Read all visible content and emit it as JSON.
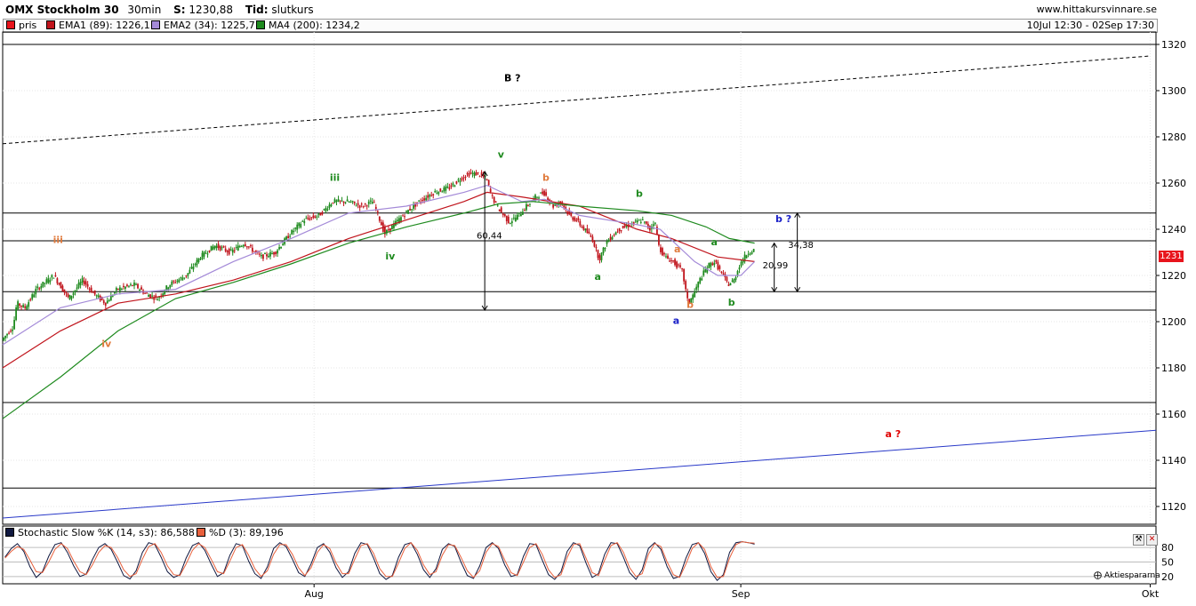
{
  "header": {
    "instrument": "OMX Stockholm 30",
    "interval": "30min",
    "s_label": "S:",
    "s_value": "1230,88",
    "tid_label": "Tid:",
    "tid_value": "slutkurs",
    "site": "www.hittakursvinnare.se"
  },
  "legend": {
    "items": [
      {
        "label": "pris",
        "color": "#e8141c"
      },
      {
        "label": "EMA1 (89): 1226,1",
        "color": "#c0141c"
      },
      {
        "label": "EMA2 (34): 1225,7",
        "color": "#a48ad8"
      },
      {
        "label": "MA4 (200): 1234,2",
        "color": "#1e8a1e"
      }
    ],
    "range": "10Jul 12:30 - 02Sep 17:30"
  },
  "last_price_badge": "1231",
  "stoch_legend": {
    "items": [
      {
        "label": "Stochastic Slow %K (14, s3): 86,588",
        "color": "#101840"
      },
      {
        "label": "%D (3): 89,196",
        "color": "#e8603c"
      }
    ]
  },
  "brand": "Aktiespararna",
  "icons": [
    "wrench-icon",
    "close-icon",
    "aktiespararna-logo-icon"
  ],
  "colors": {
    "up_candle": "#1e8a1e",
    "down_candle": "#c0141c",
    "trend_blue": "#2838c8",
    "label_green": "#1e8a1e",
    "label_orange": "#e07a3c",
    "label_blue": "#1a20c8",
    "label_red": "#e00000"
  },
  "chart_data": [
    {
      "type": "candlestick",
      "ylim": [
        1112,
        1324
      ],
      "y_ticks": [
        1120,
        1140,
        1160,
        1180,
        1200,
        1220,
        1240,
        1260,
        1280,
        1300,
        1320
      ],
      "x_ticks": [
        {
          "label": "Aug",
          "t": 0.27
        },
        {
          "label": "Sep",
          "t": 0.64
        },
        {
          "label": "Okt",
          "t": 0.995
        }
      ],
      "grid": true,
      "price_path": [
        [
          0,
          1192
        ],
        [
          0.01,
          1198
        ],
        [
          0.013,
          1208
        ],
        [
          0.02,
          1206
        ],
        [
          0.03,
          1214
        ],
        [
          0.045,
          1220
        ],
        [
          0.058,
          1210
        ],
        [
          0.07,
          1218
        ],
        [
          0.08,
          1212
        ],
        [
          0.09,
          1208
        ],
        [
          0.1,
          1214
        ],
        [
          0.115,
          1216
        ],
        [
          0.125,
          1212
        ],
        [
          0.135,
          1210
        ],
        [
          0.145,
          1216
        ],
        [
          0.16,
          1220
        ],
        [
          0.172,
          1228
        ],
        [
          0.185,
          1233
        ],
        [
          0.198,
          1230
        ],
        [
          0.21,
          1234
        ],
        [
          0.225,
          1228
        ],
        [
          0.237,
          1230
        ],
        [
          0.25,
          1238
        ],
        [
          0.262,
          1244
        ],
        [
          0.275,
          1246
        ],
        [
          0.287,
          1252
        ],
        [
          0.3,
          1252
        ],
        [
          0.312,
          1250
        ],
        [
          0.322,
          1252
        ],
        [
          0.332,
          1238
        ],
        [
          0.342,
          1243
        ],
        [
          0.352,
          1248
        ],
        [
          0.362,
          1252
        ],
        [
          0.375,
          1256
        ],
        [
          0.388,
          1258
        ],
        [
          0.398,
          1262
        ],
        [
          0.405,
          1264
        ],
        [
          0.413,
          1264
        ],
        [
          0.42,
          1262
        ],
        [
          0.425,
          1254
        ],
        [
          0.432,
          1248
        ],
        [
          0.44,
          1243
        ],
        [
          0.448,
          1246
        ],
        [
          0.455,
          1250
        ],
        [
          0.463,
          1254
        ],
        [
          0.47,
          1256
        ],
        [
          0.478,
          1250
        ],
        [
          0.485,
          1252
        ],
        [
          0.492,
          1246
        ],
        [
          0.498,
          1244
        ],
        [
          0.505,
          1240
        ],
        [
          0.512,
          1236
        ],
        [
          0.518,
          1227
        ],
        [
          0.525,
          1235
        ],
        [
          0.535,
          1240
        ],
        [
          0.545,
          1242
        ],
        [
          0.555,
          1244
        ],
        [
          0.562,
          1240
        ],
        [
          0.566,
          1244
        ],
        [
          0.57,
          1232
        ],
        [
          0.575,
          1228
        ],
        [
          0.582,
          1226
        ],
        [
          0.59,
          1222
        ],
        [
          0.595,
          1208
        ],
        [
          0.6,
          1212
        ],
        [
          0.605,
          1218
        ],
        [
          0.612,
          1224
        ],
        [
          0.618,
          1226
        ],
        [
          0.624,
          1221
        ],
        [
          0.63,
          1216
        ],
        [
          0.635,
          1218
        ],
        [
          0.64,
          1225
        ],
        [
          0.647,
          1230
        ],
        [
          0.652,
          1231
        ]
      ],
      "series": [
        {
          "name": "EMA1 (89)",
          "points": [
            [
              0,
              1180
            ],
            [
              0.05,
              1196
            ],
            [
              0.1,
              1208
            ],
            [
              0.15,
              1212
            ],
            [
              0.2,
              1218
            ],
            [
              0.25,
              1226
            ],
            [
              0.3,
              1236
            ],
            [
              0.35,
              1244
            ],
            [
              0.4,
              1252
            ],
            [
              0.42,
              1256
            ],
            [
              0.45,
              1254
            ],
            [
              0.5,
              1250
            ],
            [
              0.55,
              1240
            ],
            [
              0.58,
              1236
            ],
            [
              0.62,
              1228
            ],
            [
              0.652,
              1226
            ]
          ]
        },
        {
          "name": "EMA2 (34)",
          "points": [
            [
              0,
              1190
            ],
            [
              0.05,
              1206
            ],
            [
              0.1,
              1212
            ],
            [
              0.15,
              1214
            ],
            [
              0.2,
              1226
            ],
            [
              0.25,
              1236
            ],
            [
              0.3,
              1247
            ],
            [
              0.35,
              1250
            ],
            [
              0.4,
              1256
            ],
            [
              0.42,
              1259
            ],
            [
              0.45,
              1252
            ],
            [
              0.47,
              1253
            ],
            [
              0.5,
              1246
            ],
            [
              0.55,
              1242
            ],
            [
              0.57,
              1240
            ],
            [
              0.6,
              1226
            ],
            [
              0.62,
              1220
            ],
            [
              0.64,
              1220
            ],
            [
              0.652,
              1226
            ]
          ]
        },
        {
          "name": "MA4 (200)",
          "points": [
            [
              0,
              1158
            ],
            [
              0.05,
              1176
            ],
            [
              0.1,
              1196
            ],
            [
              0.15,
              1210
            ],
            [
              0.2,
              1217
            ],
            [
              0.25,
              1225
            ],
            [
              0.3,
              1234
            ],
            [
              0.35,
              1241
            ],
            [
              0.4,
              1247
            ],
            [
              0.43,
              1251
            ],
            [
              0.46,
              1252
            ],
            [
              0.5,
              1250
            ],
            [
              0.55,
              1248
            ],
            [
              0.58,
              1246
            ],
            [
              0.61,
              1241
            ],
            [
              0.63,
              1236
            ],
            [
              0.652,
              1234
            ]
          ]
        }
      ],
      "horizontal_lines": [
        1320,
        1247,
        1235,
        1213,
        1205,
        1165,
        1128
      ],
      "trendlines": [
        {
          "style": "dashed",
          "from": [
            0,
            1277
          ],
          "to": [
            0.995,
            1315
          ]
        },
        {
          "style": "solid-blue",
          "from": [
            0,
            1115
          ],
          "to": [
            1.0,
            1153
          ]
        }
      ],
      "annotations": [
        {
          "text": "B ?",
          "color": "black",
          "at": [
            0.442,
            1304
          ]
        },
        {
          "text": "v",
          "color": "green",
          "at": [
            0.432,
            1271
          ]
        },
        {
          "text": "iii",
          "color": "green",
          "at": [
            0.288,
            1261
          ]
        },
        {
          "text": "iv",
          "color": "green",
          "at": [
            0.336,
            1227
          ]
        },
        {
          "text": "iii",
          "color": "orange",
          "at": [
            0.048,
            1234
          ]
        },
        {
          "text": "iv",
          "color": "orange",
          "at": [
            0.09,
            1189
          ]
        },
        {
          "text": "b",
          "color": "orange",
          "at": [
            0.471,
            1261
          ]
        },
        {
          "text": "b",
          "color": "green",
          "at": [
            0.552,
            1254
          ]
        },
        {
          "text": "a",
          "color": "green",
          "at": [
            0.516,
            1218
          ]
        },
        {
          "text": "a",
          "color": "orange",
          "at": [
            0.585,
            1230
          ]
        },
        {
          "text": "a",
          "color": "green",
          "at": [
            0.617,
            1233
          ]
        },
        {
          "text": "b",
          "color": "orange",
          "at": [
            0.596,
            1206
          ]
        },
        {
          "text": "b",
          "color": "green",
          "at": [
            0.632,
            1207
          ]
        },
        {
          "text": "a",
          "color": "blue",
          "at": [
            0.584,
            1199
          ]
        },
        {
          "text": "b ?",
          "color": "blue",
          "at": [
            0.677,
            1243
          ]
        },
        {
          "text": "a ?",
          "color": "red",
          "at": [
            0.772,
            1150
          ]
        },
        {
          "text": "60,44",
          "color": "black",
          "at": [
            0.422,
            1236
          ]
        },
        {
          "text": "34,38",
          "color": "black",
          "at": [
            0.692,
            1232
          ]
        },
        {
          "text": "20,99",
          "color": "black",
          "at": [
            0.67,
            1223
          ]
        }
      ],
      "measure_lines": [
        {
          "label": "60,44",
          "x": 0.418,
          "from": 1265,
          "to": 1205
        },
        {
          "label": "34,38",
          "x": 0.689,
          "from": 1247,
          "to": 1213
        },
        {
          "label": "20,99",
          "x": 0.669,
          "from": 1234,
          "to": 1213
        }
      ]
    },
    {
      "type": "line",
      "ylim": [
        5,
        95
      ],
      "y_ticks": [
        20,
        50,
        80
      ],
      "series": [
        {
          "name": "Stochastic Slow %K (14, s3)",
          "values": [
            60,
            78,
            88,
            72,
            40,
            18,
            30,
            62,
            86,
            90,
            70,
            42,
            20,
            25,
            55,
            80,
            88,
            76,
            50,
            22,
            15,
            32,
            70,
            90,
            86,
            60,
            30,
            18,
            24,
            58,
            84,
            90,
            74,
            46,
            20,
            28,
            64,
            88,
            84,
            52,
            26,
            16,
            40,
            78,
            90,
            82,
            56,
            28,
            20,
            46,
            80,
            88,
            70,
            38,
            18,
            30,
            68,
            90,
            86,
            58,
            26,
            14,
            22,
            60,
            86,
            90,
            66,
            34,
            18,
            36,
            76,
            88,
            82,
            50,
            22,
            16,
            42,
            80,
            90,
            78,
            44,
            20,
            24,
            62,
            88,
            86,
            54,
            24,
            14,
            30,
            72,
            90,
            84,
            48,
            18,
            26,
            66,
            90,
            88,
            60,
            28,
            14,
            34,
            78,
            90,
            76,
            40,
            16,
            20,
            58,
            86,
            90,
            68,
            30,
            12,
            24,
            70,
            90,
            92,
            90,
            87
          ]
        },
        {
          "name": "%D (3)",
          "values": [
            58,
            72,
            82,
            76,
            54,
            30,
            28,
            50,
            76,
            88,
            78,
            52,
            30,
            24,
            44,
            70,
            84,
            80,
            60,
            34,
            20,
            26,
            56,
            82,
            88,
            70,
            42,
            24,
            22,
            46,
            74,
            88,
            80,
            56,
            30,
            26,
            52,
            80,
            86,
            64,
            36,
            20,
            32,
            66,
            86,
            86,
            66,
            38,
            22,
            38,
            70,
            86,
            78,
            48,
            26,
            26,
            56,
            84,
            88,
            68,
            36,
            20,
            20,
            48,
            78,
            90,
            74,
            44,
            24,
            30,
            64,
            86,
            84,
            60,
            32,
            18,
            32,
            70,
            88,
            82,
            54,
            28,
            22,
            50,
            80,
            88,
            66,
            34,
            18,
            24,
            60,
            86,
            88,
            58,
            28,
            22,
            54,
            84,
            90,
            70,
            38,
            20,
            26,
            66,
            88,
            82,
            50,
            24,
            18,
            46,
            78,
            90,
            76,
            40,
            18,
            20,
            58,
            86,
            92,
            90,
            89
          ]
        }
      ]
    }
  ]
}
